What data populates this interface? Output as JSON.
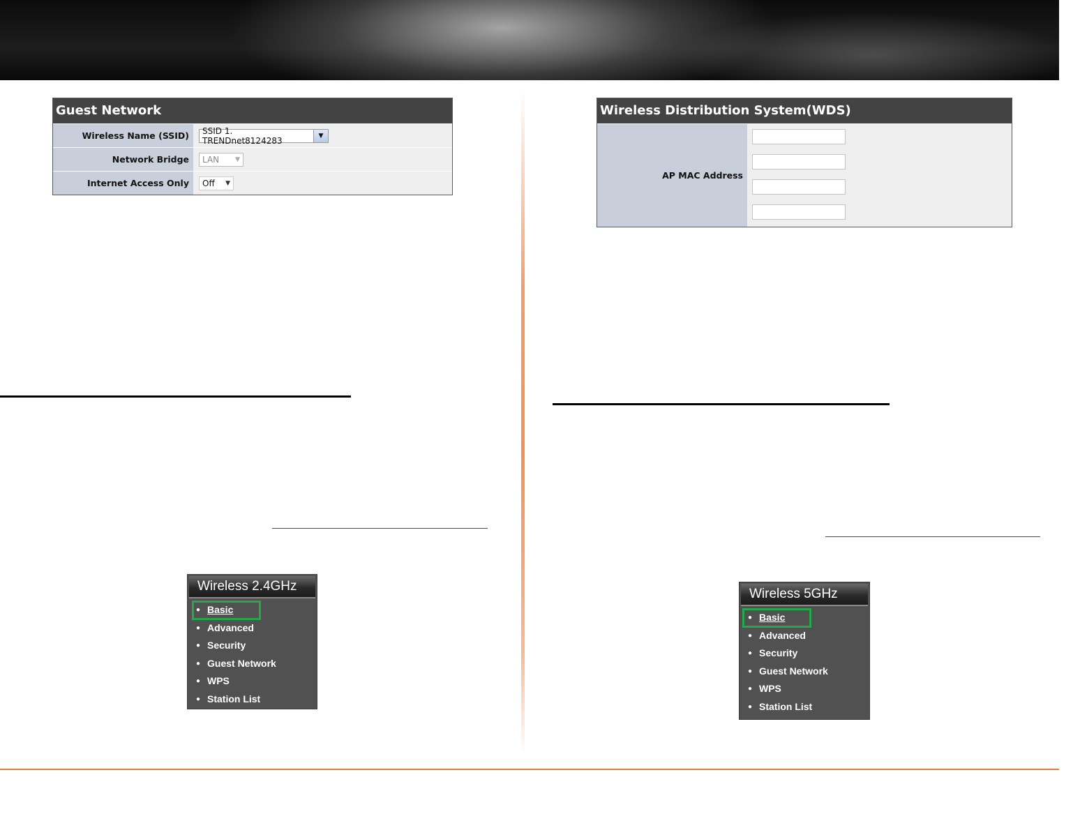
{
  "guest_network": {
    "title": "Guest Network",
    "rows": [
      {
        "label": "Wireless Name (SSID)",
        "value": "SSID 1. TRENDnet8124283"
      },
      {
        "label": "Network Bridge",
        "value": "LAN"
      },
      {
        "label": "Internet Access Only",
        "value": "Off"
      }
    ]
  },
  "wds": {
    "title": "Wireless Distribution System(WDS)",
    "label": "AP MAC Address",
    "mac_values": [
      "",
      "",
      "",
      ""
    ]
  },
  "menu_24": {
    "title": "Wireless 2.4GHz",
    "items": [
      "Basic",
      "Advanced",
      "Security",
      "Guest Network",
      "WPS",
      "Station List"
    ],
    "selected": "Basic"
  },
  "menu_5": {
    "title": "Wireless 5GHz",
    "items": [
      "Basic",
      "Advanced",
      "Security",
      "Guest Network",
      "WPS",
      "Station List"
    ],
    "selected": "Basic"
  },
  "colors": {
    "panel_header": "#434343",
    "label_cell": "#c9cfda",
    "highlight": "#23a84a",
    "accent_rule": "#e2783a"
  }
}
